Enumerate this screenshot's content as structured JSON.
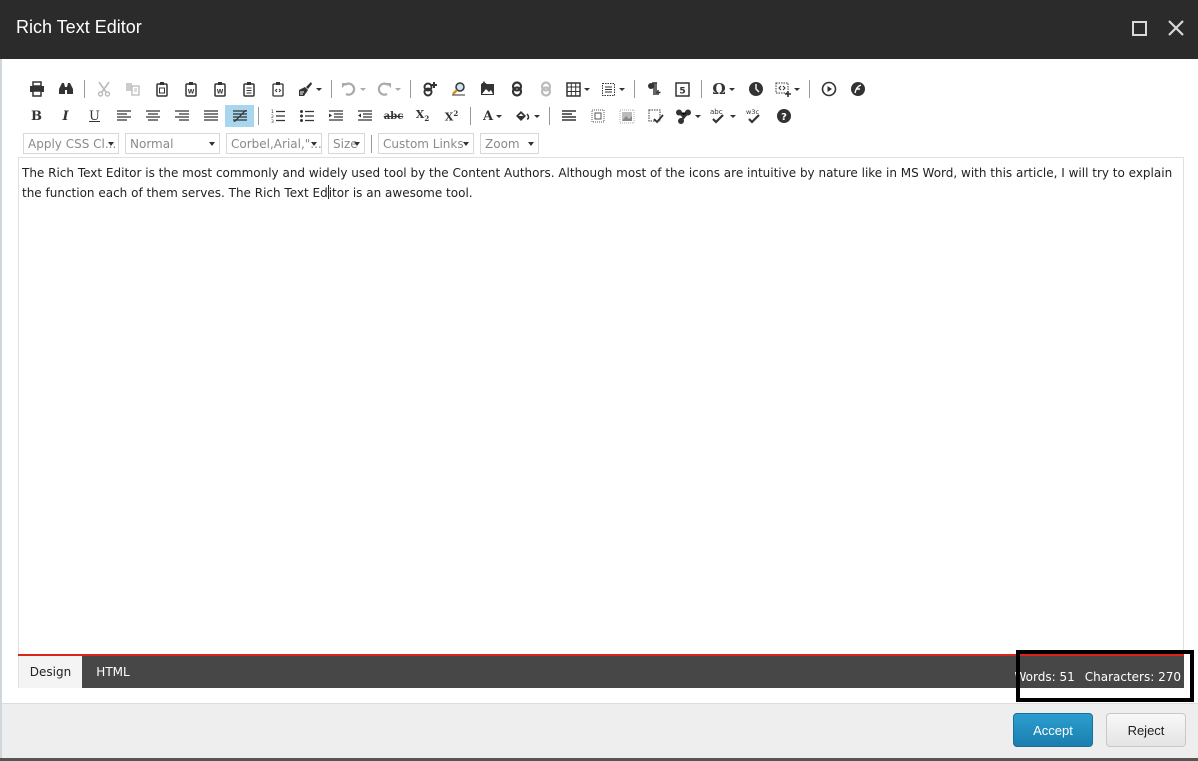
{
  "window": {
    "title": "Rich Text Editor",
    "maximize_icon": "maximize-icon",
    "close_icon": "close-icon"
  },
  "toolbar": {
    "row1": [
      {
        "name": "print",
        "icon": "print-icon"
      },
      {
        "name": "find-replace",
        "icon": "binoculars-icon"
      },
      {
        "name": "cut",
        "icon": "scissors-icon",
        "disabled": true
      },
      {
        "name": "copy",
        "icon": "copy-icon",
        "disabled": true
      },
      {
        "name": "paste",
        "icon": "clipboard-icon"
      },
      {
        "name": "paste-from-word",
        "icon": "clipboard-word-icon"
      },
      {
        "name": "paste-from-word-clean",
        "icon": "clipboard-word-clean-icon"
      },
      {
        "name": "paste-plain-text",
        "icon": "clipboard-text-icon"
      },
      {
        "name": "paste-as-html",
        "icon": "clipboard-html-icon"
      },
      {
        "name": "format-stripper",
        "icon": "brush-icon",
        "dropdown": true
      },
      {
        "name": "undo",
        "icon": "undo-icon",
        "dropdown": true,
        "disabled": true
      },
      {
        "name": "redo",
        "icon": "redo-icon",
        "dropdown": true,
        "disabled": true
      },
      {
        "name": "insert-link",
        "icon": "link-add-icon"
      },
      {
        "name": "link-manager",
        "icon": "link-search-icon"
      },
      {
        "name": "image-manager",
        "icon": "image-add-icon"
      },
      {
        "name": "hyperlink-manager",
        "icon": "link-icon"
      },
      {
        "name": "remove-link",
        "icon": "unlink-icon",
        "disabled": true
      },
      {
        "name": "insert-table",
        "icon": "table-icon",
        "dropdown": true
      },
      {
        "name": "insert-snippet",
        "icon": "snippet-icon",
        "dropdown": true
      },
      {
        "name": "insert-paragraph",
        "icon": "pilcrow-plus-icon"
      },
      {
        "name": "html5-elements",
        "icon": "html5-icon"
      },
      {
        "name": "insert-symbol",
        "icon": "omega-icon",
        "dropdown": true
      },
      {
        "name": "insert-date",
        "icon": "clock-icon"
      },
      {
        "name": "insert-code",
        "icon": "code-add-icon",
        "dropdown": true
      },
      {
        "name": "insert-media",
        "icon": "play-icon"
      },
      {
        "name": "insert-flash",
        "icon": "flash-icon"
      }
    ],
    "row2": [
      {
        "name": "bold",
        "label": "B",
        "icon": "bold-icon"
      },
      {
        "name": "italic",
        "label": "I",
        "icon": "italic-icon"
      },
      {
        "name": "underline",
        "label": "U",
        "icon": "underline-icon"
      },
      {
        "name": "align-left",
        "icon": "align-left-icon"
      },
      {
        "name": "align-center",
        "icon": "align-center-icon"
      },
      {
        "name": "align-right",
        "icon": "align-right-icon"
      },
      {
        "name": "justify",
        "icon": "justify-icon"
      },
      {
        "name": "remove-alignment",
        "icon": "remove-alignment-icon",
        "active": true
      },
      {
        "name": "numbered-list",
        "icon": "ordered-list-icon"
      },
      {
        "name": "bulleted-list",
        "icon": "unordered-list-icon"
      },
      {
        "name": "indent",
        "icon": "indent-icon"
      },
      {
        "name": "outdent",
        "icon": "outdent-icon"
      },
      {
        "name": "strikethrough",
        "label": "abc",
        "icon": "strikethrough-icon"
      },
      {
        "name": "subscript",
        "label": "X",
        "icon": "subscript-icon"
      },
      {
        "name": "superscript",
        "label": "X",
        "icon": "superscript-icon"
      },
      {
        "name": "fore-color",
        "label": "A",
        "icon": "font-color-icon",
        "dropdown": true
      },
      {
        "name": "back-color",
        "icon": "paint-bucket-icon",
        "dropdown": true
      },
      {
        "name": "paragraph-style",
        "icon": "paragraph-icon"
      },
      {
        "name": "toggle-table-border",
        "icon": "table-border-icon"
      },
      {
        "name": "image-map",
        "icon": "image-frame-icon"
      },
      {
        "name": "track-changes",
        "icon": "checklist-icon"
      },
      {
        "name": "modules",
        "icon": "modules-icon",
        "dropdown": true
      },
      {
        "name": "spellcheck",
        "icon": "spellcheck-icon",
        "dropdown": true
      },
      {
        "name": "xhtml-validator",
        "icon": "w3c-icon"
      },
      {
        "name": "help",
        "icon": "help-icon"
      }
    ],
    "dropdowns": {
      "css_class": "Apply CSS Cl...",
      "paragraph": "Normal",
      "font": "Corbel,Arial,\"...",
      "size": "Size",
      "custom_links": "Custom Links",
      "zoom": "Zoom"
    }
  },
  "editor": {
    "text_before_caret": "The Rich Text Editor is the most commonly and widely used tool by the Content Authors. Although most of the icons are intuitive by nature like in MS Word, with this article, I will try to explain the function each of them serves. The Rich Text Ed",
    "text_after_caret": "itor is an awesome tool."
  },
  "mode_tabs": {
    "design": "Design",
    "html": "HTML",
    "active": "Design"
  },
  "status": {
    "words": "Words: 51",
    "characters": "Characters: 270"
  },
  "footer": {
    "accept": "Accept",
    "reject": "Reject"
  },
  "colors": {
    "titlebar": "#2b2b2b",
    "accent_red": "#d9261c",
    "accept_blue": "#1f8dbf",
    "active_tool": "#a8d6ee",
    "bottom_bar": "#474747"
  }
}
